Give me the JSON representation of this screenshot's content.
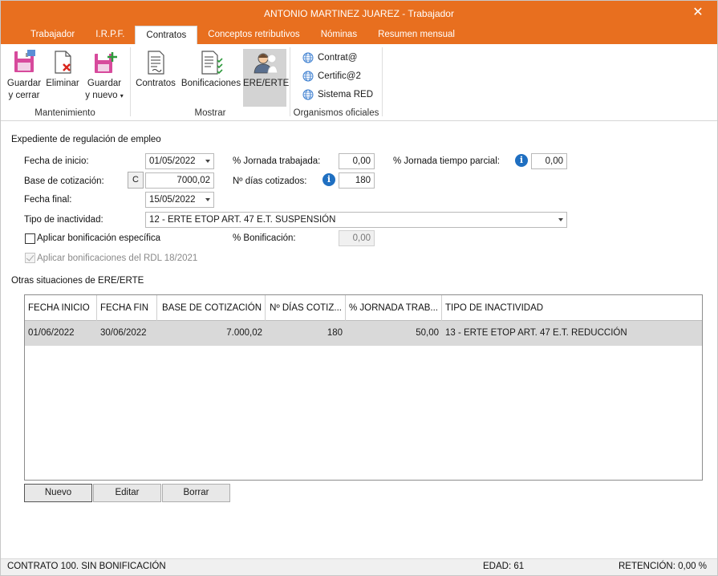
{
  "window": {
    "title": "ANTONIO MARTINEZ JUAREZ - Trabajador",
    "accent": "#e86f1f"
  },
  "tabs": [
    {
      "label": "Trabajador"
    },
    {
      "label": "I.R.P.F."
    },
    {
      "label": "Contratos",
      "active": true
    },
    {
      "label": "Conceptos retributivos"
    },
    {
      "label": "Nóminas"
    },
    {
      "label": "Resumen mensual"
    }
  ],
  "ribbon": {
    "mantenimiento": {
      "label": "Mantenimiento",
      "guardar": {
        "line1": "Guardar",
        "line2": "y cerrar",
        "icon": "save-close-icon"
      },
      "eliminar": {
        "line1": "Eliminar",
        "icon": "delete-icon"
      },
      "guardar_nuevo": {
        "line1": "Guardar",
        "line2": "y nuevo",
        "icon": "save-new-icon"
      }
    },
    "mostrar": {
      "label": "Mostrar",
      "contratos": {
        "label": "Contratos",
        "icon": "document-icon"
      },
      "bonificaciones": {
        "label": "Bonificaciones",
        "icon": "checklist-icon"
      },
      "ere": {
        "label": "ERE/ERTE",
        "icon": "person-icon"
      }
    },
    "organismos": {
      "label": "Organismos oficiales",
      "items": [
        {
          "label": "Contrat@",
          "icon": "globe-icon"
        },
        {
          "label": "Certific@2",
          "icon": "globe-icon"
        },
        {
          "label": "Sistema RED",
          "icon": "globe-icon"
        }
      ]
    }
  },
  "form": {
    "section_title": "Expediente de regulación de empleo",
    "fecha_inicio": {
      "label": "Fecha de inicio:",
      "value": "01/05/2022"
    },
    "base_cotizacion": {
      "label": "Base de cotización:",
      "button": "C",
      "value": "7000,02"
    },
    "fecha_final": {
      "label": "Fecha final:",
      "value": "15/05/2022"
    },
    "tipo_inactividad": {
      "label": "Tipo de inactividad:",
      "value": "12 - ERTE ETOP ART. 47 E.T. SUSPENSIÓN"
    },
    "jornada_trabajada": {
      "label": "% Jornada trabajada:",
      "value": "0,00"
    },
    "dias_cotizados": {
      "label": "Nº días cotizados:",
      "value": "180"
    },
    "jornada_parcial": {
      "label": "% Jornada tiempo parcial:",
      "value": "0,00"
    },
    "bonif_especifica": {
      "label": "Aplicar bonificación específica",
      "checked": false
    },
    "porc_bonificacion": {
      "label": "% Bonificación:",
      "value": "0,00"
    },
    "bonif_rdl": {
      "label": "Aplicar bonificaciones del RDL 18/2021",
      "checked": true
    }
  },
  "otras": {
    "title": "Otras situaciones de ERE/ERTE",
    "columns": [
      "FECHA INICIO",
      "FECHA FIN",
      "BASE DE COTIZACIÓN",
      "Nº DÍAS COTIZ...",
      "% JORNADA TRAB...",
      "TIPO DE INACTIVIDAD"
    ],
    "rows": [
      {
        "fecha_inicio": "01/06/2022",
        "fecha_fin": "30/06/2022",
        "base": "7.000,02",
        "dias": "180",
        "jornada": "50,00",
        "tipo": "13 - ERTE ETOP ART. 47 E.T. REDUCCIÓN"
      }
    ],
    "buttons": {
      "nuevo": "Nuevo",
      "editar": "Editar",
      "borrar": "Borrar"
    }
  },
  "statusbar": {
    "contrato": "CONTRATO 100.  SIN BONIFICACIÓN",
    "edad": "EDAD: 61",
    "retencion": "RETENCIÓN: 0,00 %"
  }
}
